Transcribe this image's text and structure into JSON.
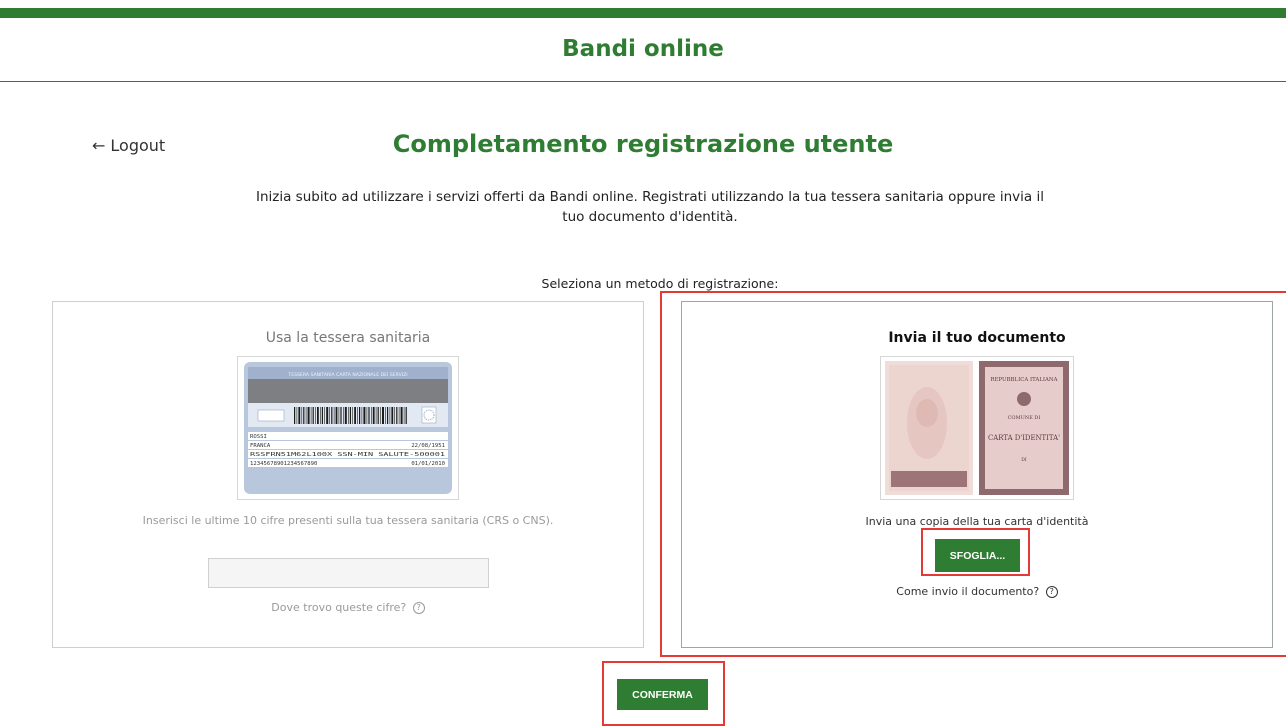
{
  "header": {
    "site_title": "Bandi online"
  },
  "nav": {
    "logout_label": "Logout",
    "logout_arrow": "←"
  },
  "page": {
    "title": "Completamento registrazione utente",
    "intro": "Inizia subito ad utilizzare i servizi offerti da Bandi online. Registrati utilizzando la tua tessera sanitaria oppure invia il tuo documento d'identità.",
    "select_label": "Seleziona un metodo di registrazione:"
  },
  "left_card": {
    "title": "Usa la tessera sanitaria",
    "card_image": {
      "header_text": "TESSERA SANITARIA CARTA NAZIONALE DEI SERVIZI",
      "surname": "ROSSI",
      "name": "FRANCA",
      "birth_date": "22/08/1951",
      "fiscal_code": "RSSFRN51M62L100X SSN-MIN SALUTE-500001",
      "card_number": "12345678901234567890",
      "expiry": "01/01/2010"
    },
    "hint": "Inserisci le ultime 10 cifre presenti sulla tua tessera sanitaria (CRS o CNS).",
    "input_value": "",
    "help_link": "Dove trovo queste cifre?",
    "help_icon": "?"
  },
  "right_card": {
    "title": "Invia il tuo documento",
    "doc_image": {
      "line1": "REPUBBLICA ITALIANA",
      "line2": "COMUNE DI",
      "line3": "CARTA D'IDENTITA'",
      "line4": "DI"
    },
    "copy_text": "Invia una copia della tua carta d'identità",
    "browse_button": "SFOGLIA...",
    "help_link": "Come invio il documento?",
    "help_icon": "?"
  },
  "confirm_button": "CONFERMA",
  "colors": {
    "brand_green": "#2e7d32",
    "highlight_red": "#e53935"
  }
}
